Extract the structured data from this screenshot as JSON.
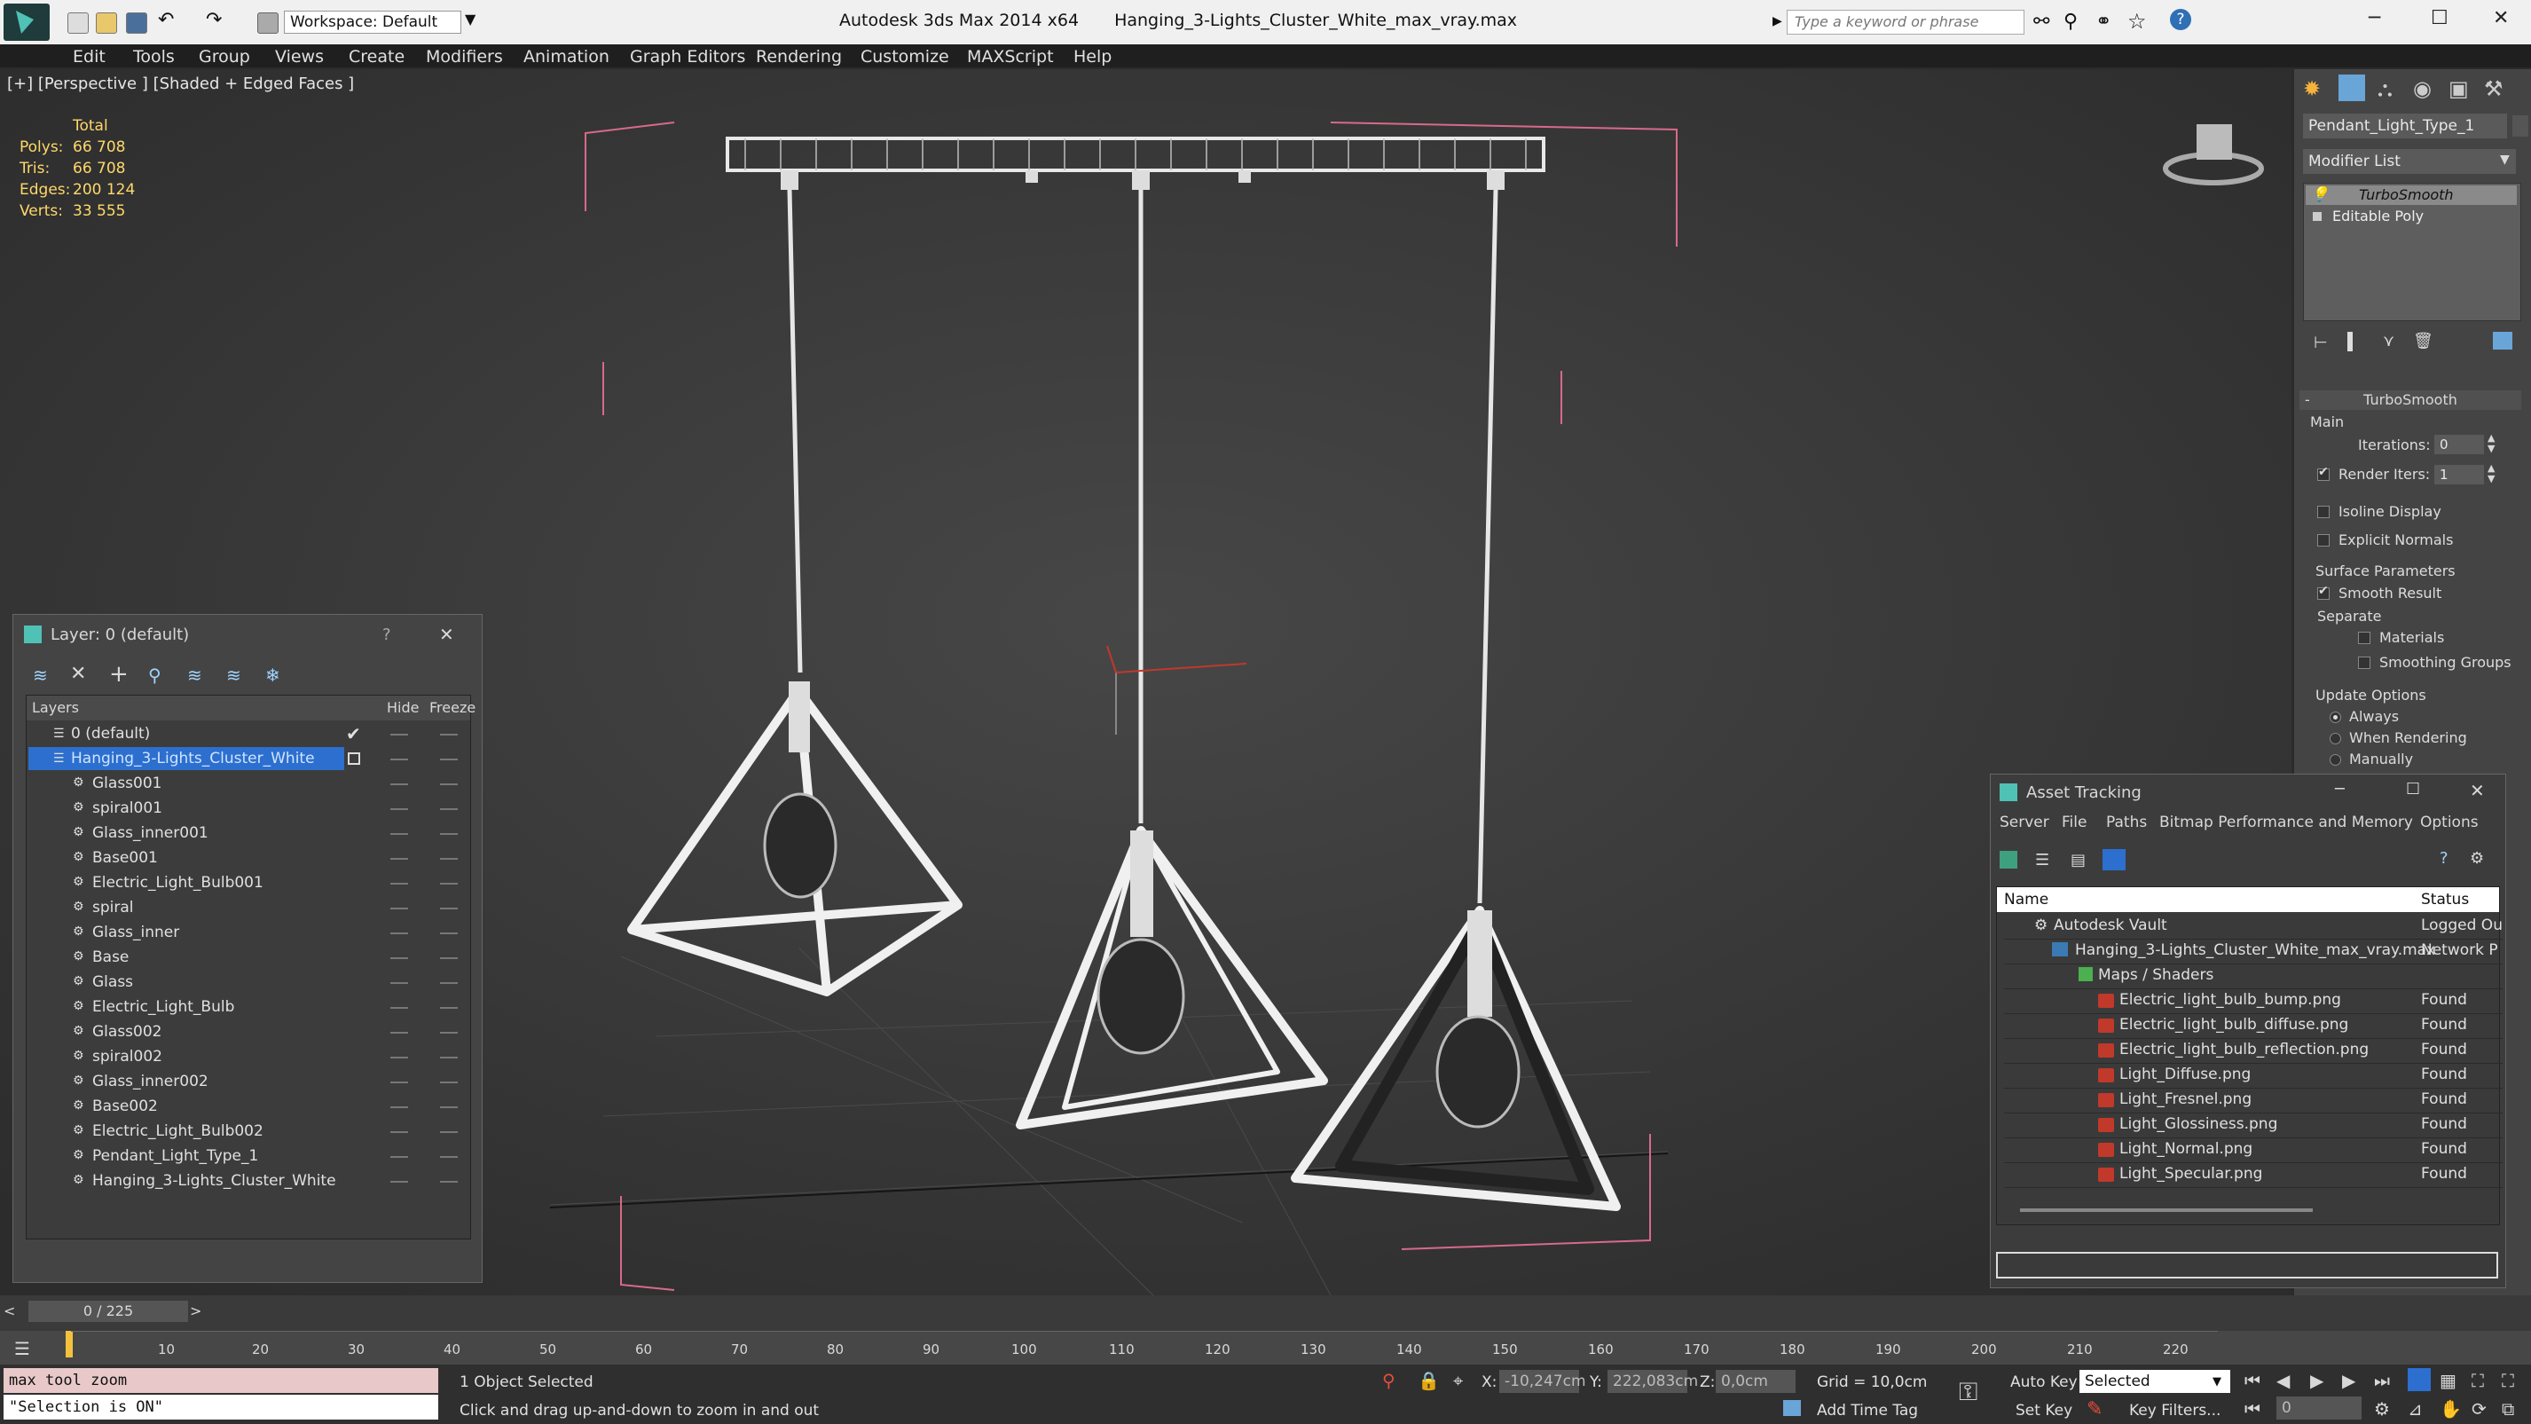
{
  "app": {
    "product": "Autodesk 3ds Max  2014 x64",
    "filename": "Hanging_3-Lights_Cluster_White_max_vray.max",
    "workspace": "Workspace: Default",
    "search_placeholder": "Type a keyword or phrase"
  },
  "menu": [
    "Edit",
    "Tools",
    "Group",
    "Views",
    "Create",
    "Modifiers",
    "Animation",
    "Graph Editors",
    "Rendering",
    "Customize",
    "MAXScript",
    "Help"
  ],
  "viewport": {
    "label": "[+] [Perspective ] [Shaded + Edged Faces ]",
    "stats": {
      "header": "Total",
      "rows": [
        {
          "label": "Polys:",
          "value": "66 708"
        },
        {
          "label": "Tris:",
          "value": "66 708"
        },
        {
          "label": "Edges:",
          "value": "200 124"
        },
        {
          "label": "Verts:",
          "value": "33 555"
        }
      ]
    }
  },
  "command_panel": {
    "object_name": "Pendant_Light_Type_1",
    "modifier_list": "Modifier List",
    "stack": [
      "TurboSmooth",
      "Editable Poly"
    ],
    "rollout_title": "TurboSmooth",
    "main_label": "Main",
    "iterations_label": "Iterations:",
    "iterations_value": "0",
    "render_iters_label": "Render Iters:",
    "render_iters_value": "1",
    "isoline": "Isoline Display",
    "explicit": "Explicit Normals",
    "surface_params": "Surface Parameters",
    "smooth_result": "Smooth Result",
    "separate": "Separate",
    "materials": "Materials",
    "smoothing_groups": "Smoothing Groups",
    "update_options": "Update Options",
    "always": "Always",
    "when_rendering": "When Rendering",
    "manually": "Manually"
  },
  "layer_dialog": {
    "title": "Layer: 0 (default)",
    "help": "?",
    "col_layers": "Layers",
    "col_hide": "Hide",
    "col_freeze": "Freeze",
    "rows": [
      {
        "name": "0 (default)",
        "level": 1
      },
      {
        "name": "Hanging_3-Lights_Cluster_White",
        "level": 1,
        "selected": true
      },
      {
        "name": "Glass001",
        "level": 2
      },
      {
        "name": "spiral001",
        "level": 2
      },
      {
        "name": "Glass_inner001",
        "level": 2
      },
      {
        "name": "Base001",
        "level": 2
      },
      {
        "name": "Electric_Light_Bulb001",
        "level": 2
      },
      {
        "name": "spiral",
        "level": 2
      },
      {
        "name": "Glass_inner",
        "level": 2
      },
      {
        "name": "Base",
        "level": 2
      },
      {
        "name": "Glass",
        "level": 2
      },
      {
        "name": "Electric_Light_Bulb",
        "level": 2
      },
      {
        "name": "Glass002",
        "level": 2
      },
      {
        "name": "spiral002",
        "level": 2
      },
      {
        "name": "Glass_inner002",
        "level": 2
      },
      {
        "name": "Base002",
        "level": 2
      },
      {
        "name": "Electric_Light_Bulb002",
        "level": 2
      },
      {
        "name": "Pendant_Light_Type_1",
        "level": 2
      },
      {
        "name": "Hanging_3-Lights_Cluster_White",
        "level": 2
      }
    ]
  },
  "asset_dialog": {
    "title": "Asset Tracking",
    "menu": [
      "Server",
      "File",
      "Paths",
      "Bitmap Performance and Memory",
      "Options"
    ],
    "col_name": "Name",
    "col_status": "Status",
    "rows": [
      {
        "name": "Autodesk Vault",
        "status": "Logged Ou",
        "level": 0
      },
      {
        "name": "Hanging_3-Lights_Cluster_White_max_vray.max",
        "status": "Network P",
        "level": 1
      },
      {
        "name": "Maps / Shaders",
        "status": "",
        "level": 2
      },
      {
        "name": "Electric_light_bulb_bump.png",
        "status": "Found",
        "level": 3
      },
      {
        "name": "Electric_light_bulb_diffuse.png",
        "status": "Found",
        "level": 3
      },
      {
        "name": "Electric_light_bulb_reflection.png",
        "status": "Found",
        "level": 3
      },
      {
        "name": "Light_Diffuse.png",
        "status": "Found",
        "level": 3
      },
      {
        "name": "Light_Fresnel.png",
        "status": "Found",
        "level": 3
      },
      {
        "name": "Light_Glossiness.png",
        "status": "Found",
        "level": 3
      },
      {
        "name": "Light_Normal.png",
        "status": "Found",
        "level": 3
      },
      {
        "name": "Light_Specular.png",
        "status": "Found",
        "level": 3
      }
    ]
  },
  "timeline": {
    "frame_counter": "0 / 225",
    "ticks": [
      "10",
      "20",
      "30",
      "40",
      "50",
      "60",
      "70",
      "80",
      "90",
      "100",
      "110",
      "120",
      "130",
      "140",
      "150",
      "160",
      "170",
      "180",
      "190",
      "200",
      "210",
      "220"
    ]
  },
  "status": {
    "script_line1": "max tool zoom",
    "script_line2": "\"Selection is ON\"",
    "selected": "1 Object Selected",
    "prompt": "Click and drag up-and-down to zoom in and out",
    "x_label": "X:",
    "x_value": "-10,247cm",
    "y_label": "Y:",
    "y_value": "222,083cm",
    "z_label": "Z:",
    "z_value": "0,0cm",
    "grid": "Grid = 10,0cm",
    "add_time_tag": "Add Time Tag",
    "auto_key": "Auto Key",
    "selected_dropdown": "Selected",
    "set_key": "Set Key",
    "key_filters": "Key Filters...",
    "frame_field": "0"
  }
}
